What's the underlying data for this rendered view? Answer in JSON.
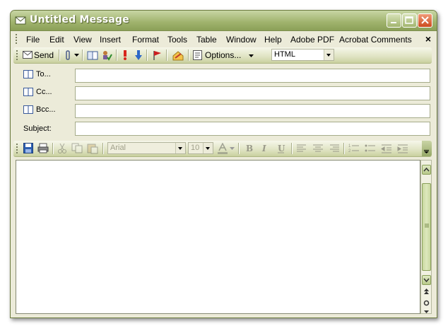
{
  "window": {
    "title": "Untitled Message"
  },
  "menubar": {
    "items": [
      "File",
      "Edit",
      "View",
      "Insert",
      "Format",
      "Tools",
      "Table",
      "Window",
      "Help",
      "Adobe PDF",
      "Acrobat Comments"
    ],
    "close_glyph": "×"
  },
  "standard_toolbar": {
    "send_label": "Send",
    "options_label": "Options...",
    "format_value": "HTML"
  },
  "header_fields": {
    "to_label": "To...",
    "cc_label": "Cc...",
    "bcc_label": "Bcc...",
    "subject_label": "Subject:",
    "to_value": "",
    "cc_value": "",
    "bcc_value": "",
    "subject_value": ""
  },
  "formatting_toolbar": {
    "font_value": "Arial",
    "size_value": "10"
  },
  "colors": {
    "title_bar": "#9fb26c",
    "window_bg": "#ecebd9",
    "close_button": "#cc4b1e"
  }
}
